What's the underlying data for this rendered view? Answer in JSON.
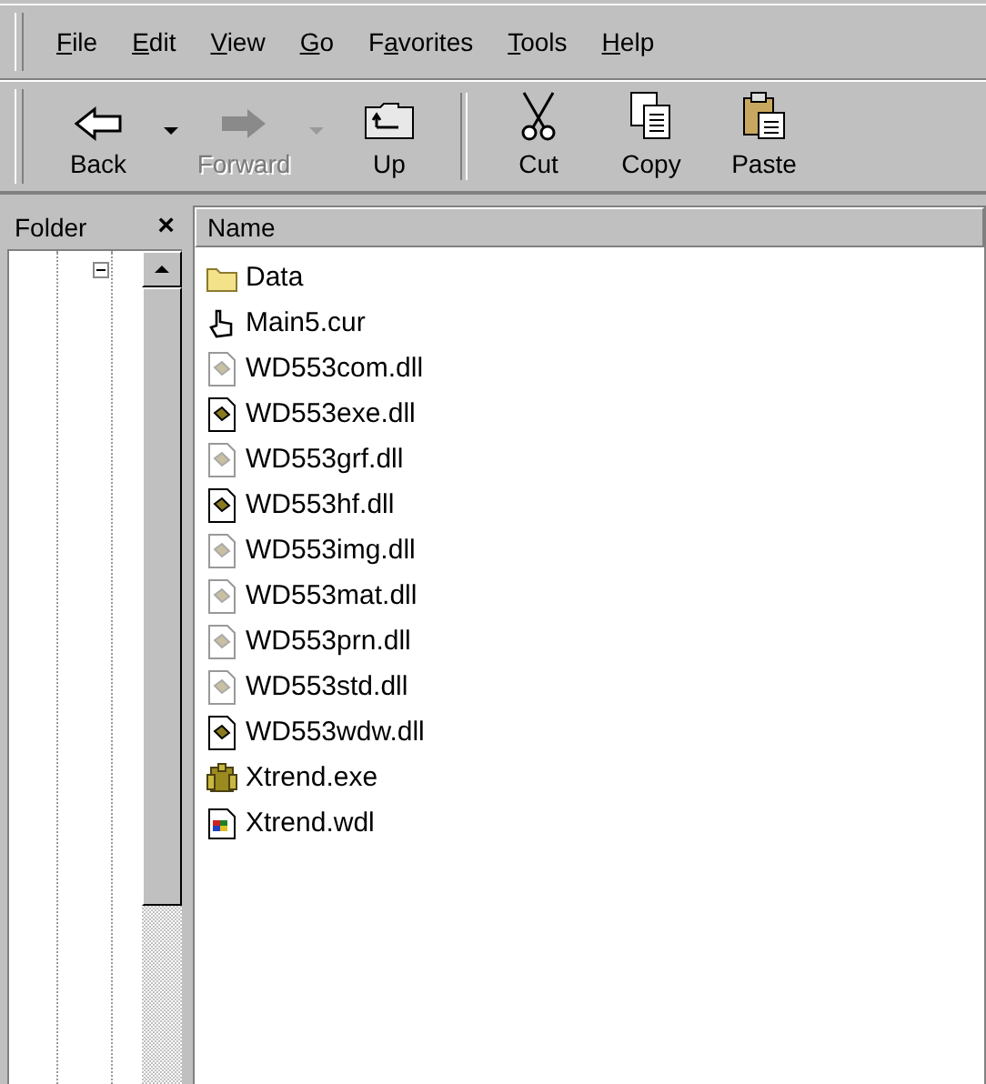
{
  "menu": [
    {
      "key": "F",
      "post": "ile"
    },
    {
      "key": "E",
      "post": "dit"
    },
    {
      "key": "V",
      "post": "iew"
    },
    {
      "key": "G",
      "post": "o"
    },
    {
      "pre": "F",
      "key": "a",
      "post": "vorites"
    },
    {
      "key": "T",
      "post": "ools"
    },
    {
      "key": "H",
      "post": "elp"
    }
  ],
  "toolbar": [
    {
      "kind": "back",
      "label": "Back",
      "disabled": false,
      "dropdown": true
    },
    {
      "kind": "forward",
      "label": "Forward",
      "disabled": true,
      "dropdown": true
    },
    {
      "kind": "up",
      "label": "Up",
      "disabled": false,
      "dropdown": false
    },
    {
      "kind": "separator"
    },
    {
      "kind": "cut",
      "label": "Cut",
      "disabled": false,
      "dropdown": false
    },
    {
      "kind": "copy",
      "label": "Copy",
      "disabled": false,
      "dropdown": false
    },
    {
      "kind": "paste",
      "label": "Paste",
      "disabled": false,
      "dropdown": false
    }
  ],
  "folder_pane": {
    "title": "Folder",
    "close": "×",
    "tree_expanded": true
  },
  "file_list": {
    "column": "Name",
    "files": [
      {
        "kind": "folder",
        "name": "Data"
      },
      {
        "kind": "cursor",
        "name": "Main5.cur"
      },
      {
        "kind": "dll",
        "name": "WD553com.dll"
      },
      {
        "kind": "dll-dark",
        "name": "WD553exe.dll"
      },
      {
        "kind": "dll",
        "name": "WD553grf.dll"
      },
      {
        "kind": "dll-dark",
        "name": "WD553hf.dll"
      },
      {
        "kind": "dll",
        "name": "WD553img.dll"
      },
      {
        "kind": "dll",
        "name": "WD553mat.dll"
      },
      {
        "kind": "dll",
        "name": "WD553prn.dll"
      },
      {
        "kind": "dll",
        "name": "WD553std.dll"
      },
      {
        "kind": "dll-dark",
        "name": "WD553wdw.dll"
      },
      {
        "kind": "exe",
        "name": "Xtrend.exe"
      },
      {
        "kind": "wdl",
        "name": "Xtrend.wdl"
      }
    ]
  }
}
